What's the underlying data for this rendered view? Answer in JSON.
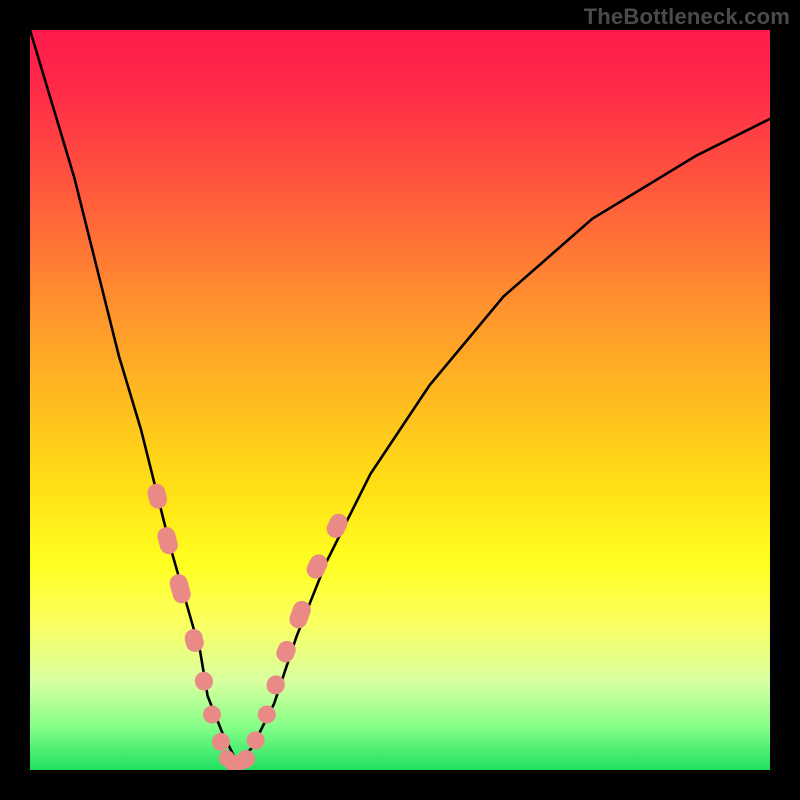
{
  "watermark": "TheBottleneck.com",
  "colors": {
    "gradient_top": "#ff1a4b",
    "gradient_bottom": "#20e060",
    "curve": "#000000",
    "series_marker": "#e98a87",
    "frame": "#000000"
  },
  "chart_data": {
    "type": "line",
    "title": "",
    "xlabel": "",
    "ylabel": "",
    "xlim": [
      0,
      100
    ],
    "ylim": [
      0,
      100
    ],
    "curve": {
      "name": "bottleneck-curve",
      "x": [
        0,
        3,
        6,
        9,
        12,
        15,
        17,
        19,
        21,
        23,
        24,
        26,
        28,
        30,
        33,
        36,
        40,
        46,
        54,
        64,
        76,
        90,
        100
      ],
      "y": [
        100,
        90,
        80,
        68,
        56,
        46,
        38,
        30,
        23,
        16,
        10,
        5,
        1,
        3,
        9,
        18,
        28,
        40,
        52,
        64,
        74.5,
        83,
        88
      ]
    },
    "series": [
      {
        "name": "highlighted-band-left",
        "type": "pill",
        "points": [
          {
            "x": 17.2,
            "y": 37.0
          },
          {
            "x": 18.6,
            "y": 31.0
          },
          {
            "x": 20.3,
            "y": 24.5
          },
          {
            "x": 22.2,
            "y": 17.5
          },
          {
            "x": 23.5,
            "y": 12.0
          },
          {
            "x": 24.6,
            "y": 7.5
          },
          {
            "x": 25.8,
            "y": 3.8
          }
        ]
      },
      {
        "name": "highlighted-band-right",
        "type": "pill",
        "points": [
          {
            "x": 29.2,
            "y": 1.5
          },
          {
            "x": 30.5,
            "y": 4.0
          },
          {
            "x": 32.0,
            "y": 7.5
          },
          {
            "x": 33.2,
            "y": 11.5
          },
          {
            "x": 34.6,
            "y": 16.0
          },
          {
            "x": 36.5,
            "y": 21.0
          },
          {
            "x": 38.8,
            "y": 27.5
          },
          {
            "x": 41.5,
            "y": 33.0
          }
        ]
      },
      {
        "name": "valley-dots",
        "type": "dot",
        "points": [
          {
            "x": 26.6,
            "y": 1.6
          },
          {
            "x": 27.3,
            "y": 1.0
          },
          {
            "x": 28.0,
            "y": 0.8
          },
          {
            "x": 28.8,
            "y": 1.2
          }
        ]
      }
    ]
  }
}
